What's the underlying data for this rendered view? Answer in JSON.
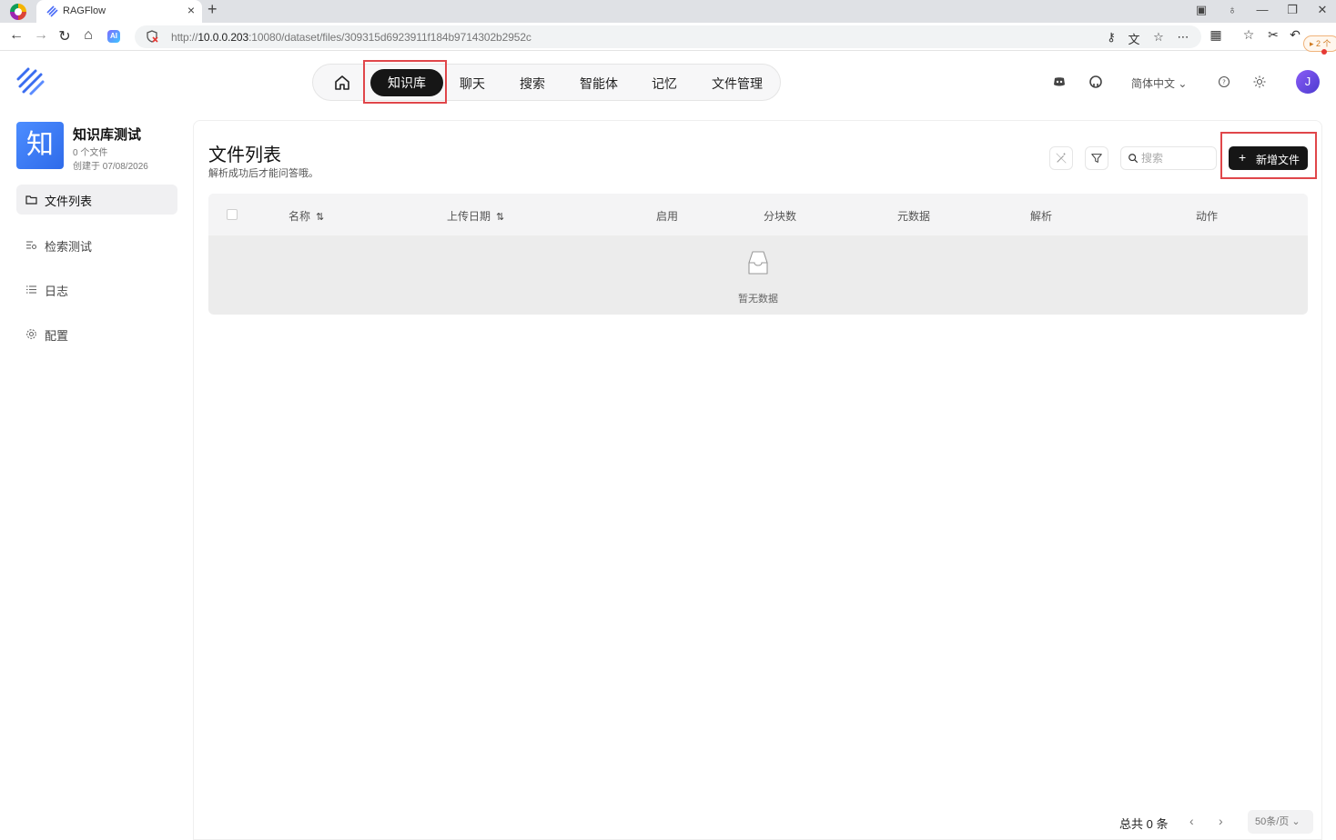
{
  "browser": {
    "tab_title": "RAGFlow",
    "tab_close": "×",
    "new_tab": "+",
    "url_prefix": "http://",
    "url_host": "10.0.0.203",
    "url_rest": ":10080/dataset/files/309315d6923911f184b9714302b2952c",
    "badge": "▸ 2 个",
    "icons": [
      "back-icon",
      "forward-icon",
      "reload-icon",
      "home-icon",
      "ai-icon",
      "key-icon",
      "translate-icon",
      "star-icon",
      "more-icon",
      "apps-icon",
      "favorites-icon",
      "screenshot-icon",
      "undo-icon"
    ]
  },
  "nav": {
    "items": [
      {
        "label": "知识库",
        "active": true
      },
      {
        "label": "聊天"
      },
      {
        "label": "搜索"
      },
      {
        "label": "智能体"
      },
      {
        "label": "记忆"
      },
      {
        "label": "文件管理"
      }
    ]
  },
  "header": {
    "language": "简体中文 ⌄",
    "avatar_letter": "J"
  },
  "dataset": {
    "avatar_char": "知",
    "name": "知识库测试",
    "file_count": "0 个文件",
    "created": "创建于 07/08/2026"
  },
  "sidebar": {
    "items": [
      {
        "label": "文件列表",
        "icon": "folder-icon",
        "active": true
      },
      {
        "label": "检索测试",
        "icon": "retrieval-icon"
      },
      {
        "label": "日志",
        "icon": "list-icon"
      },
      {
        "label": "配置",
        "icon": "gear-icon"
      }
    ]
  },
  "main": {
    "title": "文件列表",
    "subtitle": "解析成功后才能问答哦。",
    "search_placeholder": "搜索",
    "add_button": "新增文件",
    "add_plus": "+",
    "columns": [
      "名称",
      "上传日期",
      "启用",
      "分块数",
      "元数据",
      "解析",
      "动作"
    ],
    "sort_glyph": "⇅",
    "empty_text": "暂无数据"
  },
  "pagination": {
    "total": "总共 0 条",
    "prev": "‹",
    "next": "›",
    "page_size": "50条/页 ⌄"
  },
  "colors": {
    "accent": "#161616",
    "highlight": "#e0464a",
    "brand": "#3b6df0"
  }
}
